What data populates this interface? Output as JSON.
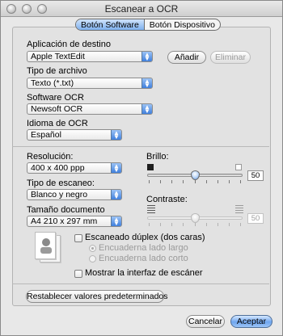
{
  "window": {
    "title": "Escanear a OCR"
  },
  "tabs": [
    {
      "label": "Botón Software",
      "active": true
    },
    {
      "label": "Botón Dispositivo",
      "active": false
    }
  ],
  "destino": {
    "label": "Aplicación de destino",
    "value": "Apple TextEdit",
    "add_label": "Añadir",
    "remove_label": "Eliminar"
  },
  "tipo_archivo": {
    "label": "Tipo de archivo",
    "value": "Texto (*.txt)"
  },
  "software_ocr": {
    "label": "Software OCR",
    "value": "Newsoft OCR"
  },
  "idioma_ocr": {
    "label": "Idioma de OCR",
    "value": "Español"
  },
  "resolucion": {
    "label": "Resolución:",
    "value": "400 x 400 ppp"
  },
  "tipo_escaneo": {
    "label": "Tipo de escaneo:",
    "value": "Blanco y negro"
  },
  "tamano": {
    "label": "Tamaño documento",
    "value": "A4  210 x 297 mm"
  },
  "brillo": {
    "label": "Brillo:",
    "value": "50",
    "level": 0.5
  },
  "contraste": {
    "label": "Contraste:",
    "value": "50",
    "level": 0.5,
    "disabled": true
  },
  "duplex": {
    "label": "Escaneado dúplex (dos caras)",
    "checked": false,
    "option_long": "Encuaderna lado largo",
    "option_short": "Encuaderna lado corto"
  },
  "interfaz": {
    "label": "Mostrar la interfaz de escáner",
    "checked": false
  },
  "restablecer_label": "Restablecer valores predeterminados",
  "cancel_label": "Cancelar",
  "accept_label": "Aceptar",
  "colors": {
    "accent": "#5b9ae8",
    "window_bg": "#e8e8e8",
    "panel_bg": "#e2e2e2"
  }
}
